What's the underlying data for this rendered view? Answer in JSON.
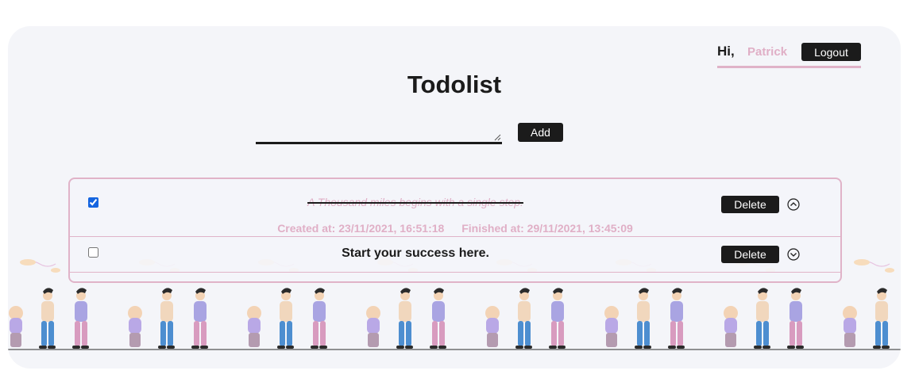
{
  "header": {
    "greeting": "Hi,",
    "username": "Patrick",
    "logout_label": "Logout"
  },
  "title": "Todolist",
  "composer": {
    "value": "",
    "placeholder": "",
    "add_label": "Add"
  },
  "todos": [
    {
      "text": "A Thousand miles begins with a single step.",
      "checked": true,
      "delete_label": "Delete",
      "toggle_icon": "chevron-up-circle-icon",
      "created_label": "Created at: 23/11/2021, 16:51:18",
      "finished_label": "Finished at: 29/11/2021, 13:45:09"
    },
    {
      "text": "Start your success here.",
      "checked": false,
      "delete_label": "Delete",
      "toggle_icon": "chevron-down-circle-icon"
    }
  ],
  "colors": {
    "accent_pink": "#e0afc6",
    "dark": "#1b1b1b",
    "card_bg": "#f4f5f9"
  }
}
